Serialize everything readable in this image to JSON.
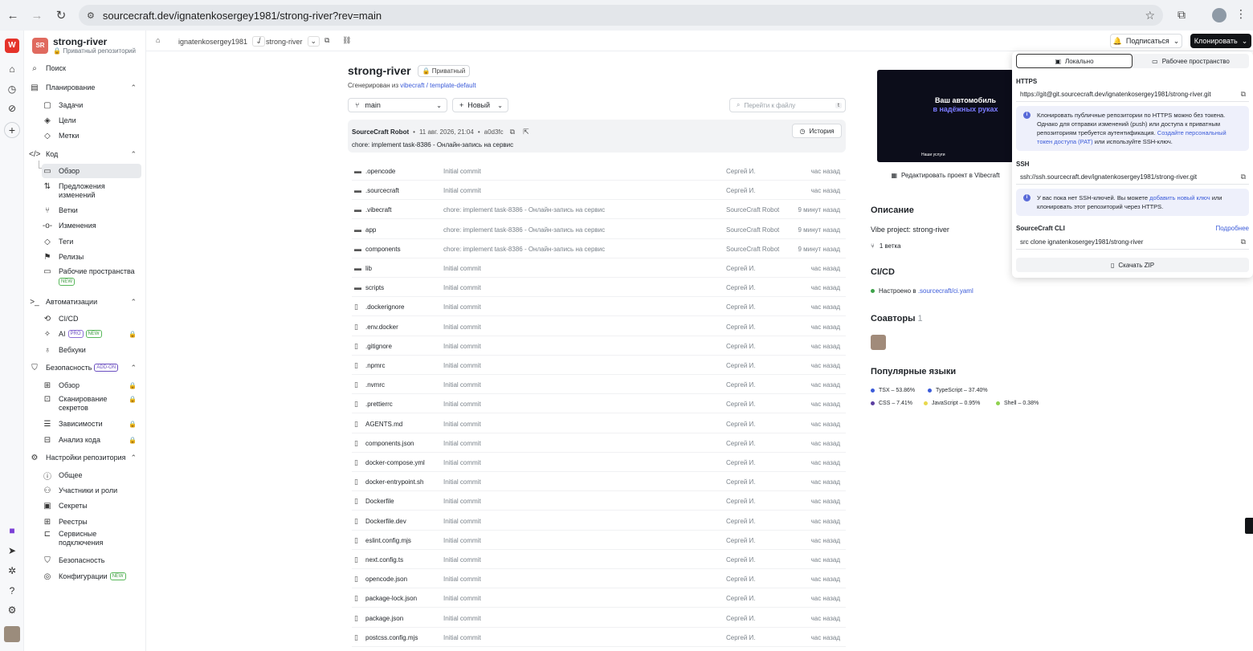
{
  "browser": {
    "url": "sourcecraft.dev/ignatenkosergey1981/strong-river?rev=main"
  },
  "repo": {
    "avatar": "SR",
    "name": "strong-river",
    "subtitle": "Приватный репозиторий"
  },
  "sidebar": {
    "search": "Поиск",
    "planning": "Планирование",
    "tasks": "Задачи",
    "goals": "Цели",
    "labels": "Метки",
    "code": "Код",
    "overview": "Обзор",
    "proposals": "Предложения изменений",
    "branches": "Ветки",
    "changes": "Изменения",
    "tags": "Теги",
    "releases": "Релизы",
    "workspaces": "Рабочие пространства",
    "new_badge": "NEW",
    "automation": "Автоматизации",
    "cicd": "CI/CD",
    "ai": "AI",
    "pro_badge": "PRO",
    "webhooks": "Вебхуки",
    "security": "Безопасность",
    "addon_badge": "ADD-ON",
    "sec_overview": "Обзор",
    "secret_scan": "Сканирование секретов",
    "dependencies": "Зависимости",
    "code_analysis": "Анализ кода",
    "repo_settings": "Настройки репозитория",
    "general": "Общее",
    "members": "Участники и роли",
    "secrets": "Секреты",
    "registries": "Реестры",
    "service_conn": "Сервисные подключения",
    "sec_settings": "Безопасность",
    "configs": "Конфигурации"
  },
  "topbar": {
    "owner": "ignatenkosergey1981",
    "repo": "strong-river",
    "subscribe": "Подписаться",
    "clone": "Клонировать"
  },
  "main": {
    "title": "strong-river",
    "private_badge": "Приватный",
    "generated_prefix": "Сгенерирован из",
    "generated_link": "vibecraft / template-default",
    "branch": "main",
    "new_btn": "Новый",
    "search_placeholder": "Перейти к файлу",
    "search_kbd": "t",
    "commit": {
      "author": "SourceCraft Robot",
      "date": "11 авг. 2026, 21:04",
      "hash": "a0d3fc",
      "message": "chore: implement task-8386 - Онлайн-запись на сервис",
      "history": "История"
    },
    "files": [
      {
        "name": ".opencode",
        "type": "dir",
        "msg": "Initial commit",
        "author": "Сергей И.",
        "time": "час назад"
      },
      {
        "name": ".sourcecraft",
        "type": "dir",
        "msg": "Initial commit",
        "author": "Сергей И.",
        "time": "час назад"
      },
      {
        "name": ".vibecraft",
        "type": "dir",
        "msg": "chore: implement task-8386 - Онлайн-запись на сервис",
        "author": "SourceCraft Robot",
        "time": "9 минут назад"
      },
      {
        "name": "app",
        "type": "dir",
        "msg": "chore: implement task-8386 - Онлайн-запись на сервис",
        "author": "SourceCraft Robot",
        "time": "9 минут назад"
      },
      {
        "name": "components",
        "type": "dir",
        "msg": "chore: implement task-8386 - Онлайн-запись на сервис",
        "author": "SourceCraft Robot",
        "time": "9 минут назад"
      },
      {
        "name": "lib",
        "type": "dir",
        "msg": "Initial commit",
        "author": "Сергей И.",
        "time": "час назад"
      },
      {
        "name": "scripts",
        "type": "dir",
        "msg": "Initial commit",
        "author": "Сергей И.",
        "time": "час назад"
      },
      {
        "name": ".dockerignore",
        "type": "file",
        "msg": "Initial commit",
        "author": "Сергей И.",
        "time": "час назад"
      },
      {
        "name": ".env.docker",
        "type": "file",
        "msg": "Initial commit",
        "author": "Сергей И.",
        "time": "час назад"
      },
      {
        "name": ".gitignore",
        "type": "file",
        "msg": "Initial commit",
        "author": "Сергей И.",
        "time": "час назад"
      },
      {
        "name": ".npmrc",
        "type": "file",
        "msg": "Initial commit",
        "author": "Сергей И.",
        "time": "час назад"
      },
      {
        "name": ".nvmrc",
        "type": "file",
        "msg": "Initial commit",
        "author": "Сергей И.",
        "time": "час назад"
      },
      {
        "name": ".prettierrc",
        "type": "file",
        "msg": "Initial commit",
        "author": "Сергей И.",
        "time": "час назад"
      },
      {
        "name": "AGENTS.md",
        "type": "file",
        "msg": "Initial commit",
        "author": "Сергей И.",
        "time": "час назад"
      },
      {
        "name": "components.json",
        "type": "file",
        "msg": "Initial commit",
        "author": "Сергей И.",
        "time": "час назад"
      },
      {
        "name": "docker-compose.yml",
        "type": "file",
        "msg": "Initial commit",
        "author": "Сергей И.",
        "time": "час назад"
      },
      {
        "name": "docker-entrypoint.sh",
        "type": "file",
        "msg": "Initial commit",
        "author": "Сергей И.",
        "time": "час назад"
      },
      {
        "name": "Dockerfile",
        "type": "file",
        "msg": "Initial commit",
        "author": "Сергей И.",
        "time": "час назад"
      },
      {
        "name": "Dockerfile.dev",
        "type": "file",
        "msg": "Initial commit",
        "author": "Сергей И.",
        "time": "час назад"
      },
      {
        "name": "eslint.config.mjs",
        "type": "file",
        "msg": "Initial commit",
        "author": "Сергей И.",
        "time": "час назад"
      },
      {
        "name": "next.config.ts",
        "type": "file",
        "msg": "Initial commit",
        "author": "Сергей И.",
        "time": "час назад"
      },
      {
        "name": "opencode.json",
        "type": "file",
        "msg": "Initial commit",
        "author": "Сергей И.",
        "time": "час назад"
      },
      {
        "name": "package-lock.json",
        "type": "file",
        "msg": "Initial commit",
        "author": "Сергей И.",
        "time": "час назад"
      },
      {
        "name": "package.json",
        "type": "file",
        "msg": "Initial commit",
        "author": "Сергей И.",
        "time": "час назад"
      },
      {
        "name": "postcss.config.mjs",
        "type": "file",
        "msg": "Initial commit",
        "author": "Сергей И.",
        "time": "час назад"
      }
    ]
  },
  "info": {
    "preview_head1": "Ваш автомобиль",
    "preview_head2": "в надёжных руках",
    "preview_foot": "Наши услуги",
    "edit_vibe": "Редактировать проект в Vibecraft",
    "description_h": "Описание",
    "description": "Vibe project: strong-river",
    "branch_count": "1 ветка",
    "cicd_h": "CI/CD",
    "cicd_prefix": "Настроено в",
    "cicd_link": ".sourcecraft/ci.yaml",
    "coauthors_h": "Соавторы",
    "coauthors_count": "1",
    "languages_h": "Популярные языки",
    "languages": [
      {
        "name": "TSX – 53.86%",
        "color": "#3b5bd9"
      },
      {
        "name": "TypeScript – 37.40%",
        "color": "#3b5bd9"
      },
      {
        "name": "CSS – 7.41%",
        "color": "#5b3ea0"
      },
      {
        "name": "JavaScript – 0.95%",
        "color": "#e8d84c"
      },
      {
        "name": "Shell – 0.38%",
        "color": "#8fd14f"
      }
    ]
  },
  "clone_popup": {
    "tab_local": "Локально",
    "tab_workspace": "Рабочее пространство",
    "https_label": "HTTPS",
    "https_url": "https://git@git.sourcecraft.dev/ignatenkosergey1981/strong-river.git",
    "https_info_1": "Клонировать публичные репозитории по HTTPS можно без токена. Однако для отправки изменений (push) или доступа к приватным репозиториям требуется аутентификация.",
    "https_info_link": "Создайте персональный токен доступа (PAT)",
    "https_info_2": "или используйте SSH-ключ.",
    "ssh_label": "SSH",
    "ssh_url": "ssh://ssh.sourcecraft.dev/ignatenkosergey1981/strong-river.git",
    "ssh_info_1": "У вас пока нет SSH-ключей. Вы можете",
    "ssh_info_link": "добавить новый ключ",
    "ssh_info_2": "или клонировать этот репозиторий через HTTPS.",
    "cli_label": "SourceCraft CLI",
    "cli_more": "Подробнее",
    "cli_cmd": "src clone ignatenkosergey1981/strong-river",
    "download_zip": "Скачать ZIP"
  }
}
